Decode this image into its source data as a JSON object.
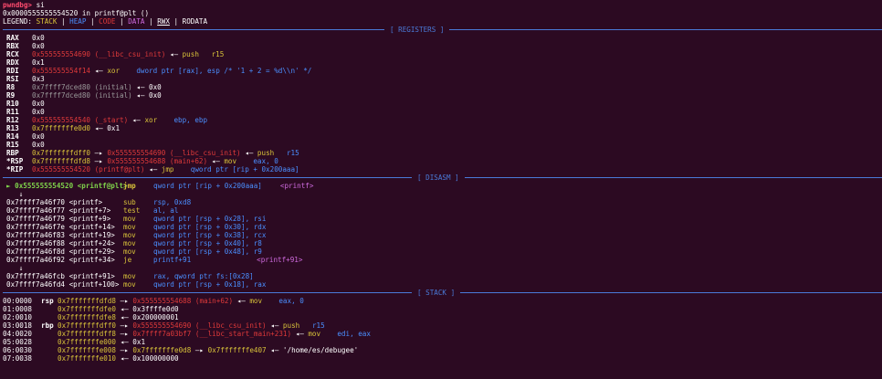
{
  "prompt": {
    "name": "pwndbg>",
    "cmd": " si"
  },
  "status_line": "0x0000555555554520 in printf@plt ()",
  "legend": {
    "prefix": "LEGEND: ",
    "stack": "STACK",
    "heap": "HEAP",
    "code": "CODE",
    "data": "DATA",
    "rwx": "RWX",
    "rodata": "RODATA",
    "sep": " | "
  },
  "sections": {
    "registers": "[ REGISTERS ]",
    "disasm": "[ DISASM ]",
    "stack": "[ STACK ]"
  },
  "registers": [
    {
      "name": "RAX",
      "parts": [
        [
          "w",
          "0x0"
        ]
      ]
    },
    {
      "name": "RBX",
      "parts": [
        [
          "w",
          "0x0"
        ]
      ]
    },
    {
      "name": "RCX",
      "parts": [
        [
          "red",
          "0x555555554690 (__libc_csu_init)"
        ],
        [
          "w",
          " ◂— "
        ],
        [
          "yel",
          "push   r15"
        ]
      ]
    },
    {
      "name": "RDX",
      "parts": [
        [
          "w",
          "0x1"
        ]
      ]
    },
    {
      "name": "RDI",
      "parts": [
        [
          "red",
          "0x555555554f14"
        ],
        [
          "w",
          " ◂— "
        ],
        [
          "yel",
          "xor    "
        ],
        [
          "blue",
          "dword ptr [rax], esp /* '1 + 2 = %d\\\\n' */"
        ]
      ]
    },
    {
      "name": "RSI",
      "parts": [
        [
          "w",
          "0x3"
        ]
      ]
    },
    {
      "name": "R8",
      "parts": [
        [
          "gray",
          "0x7ffff7dced80 (initial)"
        ],
        [
          "w",
          " ◂— 0x0"
        ]
      ]
    },
    {
      "name": "R9",
      "parts": [
        [
          "gray",
          "0x7ffff7dced80 (initial)"
        ],
        [
          "w",
          " ◂— 0x0"
        ]
      ]
    },
    {
      "name": "R10",
      "parts": [
        [
          "w",
          "0x0"
        ]
      ]
    },
    {
      "name": "R11",
      "parts": [
        [
          "w",
          "0x0"
        ]
      ]
    },
    {
      "name": "R12",
      "parts": [
        [
          "red",
          "0x555555554540 (_start)"
        ],
        [
          "w",
          " ◂— "
        ],
        [
          "yel",
          "xor    "
        ],
        [
          "blue",
          "ebp, ebp"
        ]
      ]
    },
    {
      "name": "R13",
      "parts": [
        [
          "yel",
          "0x7fffffffe0d0"
        ],
        [
          "w",
          " ◂— 0x1"
        ]
      ]
    },
    {
      "name": "R14",
      "parts": [
        [
          "w",
          "0x0"
        ]
      ]
    },
    {
      "name": "R15",
      "parts": [
        [
          "w",
          "0x0"
        ]
      ]
    },
    {
      "name": "RBP",
      "parts": [
        [
          "yel",
          "0x7fffffffdff0"
        ],
        [
          "w",
          " —▸ "
        ],
        [
          "red",
          "0x555555554690 (__libc_csu_init)"
        ],
        [
          "w",
          " ◂— "
        ],
        [
          "yel",
          "push   "
        ],
        [
          "blue",
          "r15"
        ]
      ]
    },
    {
      "name": "*RSP",
      "parts": [
        [
          "yel",
          "0x7fffffffdfd8"
        ],
        [
          "w",
          " —▸ "
        ],
        [
          "red",
          "0x555555554688 (main+62)"
        ],
        [
          "w",
          " ◂— "
        ],
        [
          "yel",
          "mov    "
        ],
        [
          "blue",
          "eax, 0"
        ]
      ]
    },
    {
      "name": "*RIP",
      "parts": [
        [
          "red",
          "0x555555554520 (printf@plt)"
        ],
        [
          "w",
          " ◂— "
        ],
        [
          "yel",
          "jmp    "
        ],
        [
          "blue",
          "qword ptr [rip + 0x200aaa]"
        ]
      ]
    }
  ],
  "disasm": [
    {
      "cur": true,
      "addr": "► 0x555555554520 <printf@plt>",
      "mn": "jmp",
      "ops": "qword ptr [rip + 0x200aaa]",
      "extra": "<printf>"
    },
    {
      "arrow": "↓"
    },
    {
      "addr": "0x7ffff7a46f70 <printf>",
      "mn": "sub",
      "ops": "rsp, 0xd8"
    },
    {
      "addr": "0x7ffff7a46f77 <printf+7>",
      "mn": "test",
      "ops": "al, al"
    },
    {
      "addr": "0x7ffff7a46f79 <printf+9>",
      "mn": "mov",
      "ops": "qword ptr [rsp + 0x28], rsi"
    },
    {
      "addr": "0x7ffff7a46f7e <printf+14>",
      "mn": "mov",
      "ops": "qword ptr [rsp + 0x30], rdx"
    },
    {
      "addr": "0x7ffff7a46f83 <printf+19>",
      "mn": "mov",
      "ops": "qword ptr [rsp + 0x38], rcx"
    },
    {
      "addr": "0x7ffff7a46f88 <printf+24>",
      "mn": "mov",
      "ops": "qword ptr [rsp + 0x40], r8"
    },
    {
      "addr": "0x7ffff7a46f8d <printf+29>",
      "mn": "mov",
      "ops": "qword ptr [rsp + 0x48], r9"
    },
    {
      "addr": "0x7ffff7a46f92 <printf+34>",
      "mn": "je",
      "ops": "printf+91",
      "extra": "<printf+91>"
    },
    {
      "arrow": "↓"
    },
    {
      "addr": "0x7ffff7a46fcb <printf+91>",
      "mn": "mov",
      "ops": "rax, qword ptr fs:[0x28]"
    },
    {
      "addr": "0x7ffff7a46fd4 <printf+100>",
      "mn": "mov",
      "ops": "qword ptr [rsp + 0x18], rax"
    }
  ],
  "stack": [
    {
      "off": "00:0000",
      "reg": "rsp",
      "parts": [
        [
          "yel",
          "0x7fffffffdfd8"
        ],
        [
          "w",
          " —▸ "
        ],
        [
          "red",
          "0x555555554688 (main+62)"
        ],
        [
          "w",
          " ◂— "
        ],
        [
          "yel",
          "mov    "
        ],
        [
          "blue",
          "eax, 0"
        ]
      ]
    },
    {
      "off": "01:0008",
      "reg": "",
      "parts": [
        [
          "yel",
          "0x7fffffffdfe0"
        ],
        [
          "w",
          " ◂— 0x3ffffe0d0"
        ]
      ]
    },
    {
      "off": "02:0010",
      "reg": "",
      "parts": [
        [
          "yel",
          "0x7fffffffdfe8"
        ],
        [
          "w",
          " ◂— 0x200000001"
        ]
      ]
    },
    {
      "off": "03:0018",
      "reg": "rbp",
      "parts": [
        [
          "yel",
          "0x7fffffffdff0"
        ],
        [
          "w",
          " —▸ "
        ],
        [
          "red",
          "0x555555554690 (__libc_csu_init)"
        ],
        [
          "w",
          " ◂— "
        ],
        [
          "yel",
          "push   "
        ],
        [
          "blue",
          "r15"
        ]
      ]
    },
    {
      "off": "04:0020",
      "reg": "",
      "parts": [
        [
          "yel",
          "0x7fffffffdff8"
        ],
        [
          "w",
          " —▸ "
        ],
        [
          "red",
          "0x7ffff7a03bf7 (__libc_start_main+231)"
        ],
        [
          "w",
          " ◂— "
        ],
        [
          "yel",
          "mov    "
        ],
        [
          "blue",
          "edi, eax"
        ]
      ]
    },
    {
      "off": "05:0028",
      "reg": "",
      "parts": [
        [
          "yel",
          "0x7fffffffe000"
        ],
        [
          "w",
          " ◂— 0x1"
        ]
      ]
    },
    {
      "off": "06:0030",
      "reg": "",
      "parts": [
        [
          "yel",
          "0x7fffffffe008"
        ],
        [
          "w",
          " —▸ "
        ],
        [
          "yel",
          "0x7fffffffe0d8"
        ],
        [
          "w",
          " —▸ "
        ],
        [
          "yel",
          "0x7fffffffe407"
        ],
        [
          "w",
          " ◂— '/home/es/debugee'"
        ]
      ]
    },
    {
      "off": "07:0038",
      "reg": "",
      "parts": [
        [
          "yel",
          "0x7fffffffe010"
        ],
        [
          "w",
          " ◂— 0x100000000"
        ]
      ]
    }
  ]
}
